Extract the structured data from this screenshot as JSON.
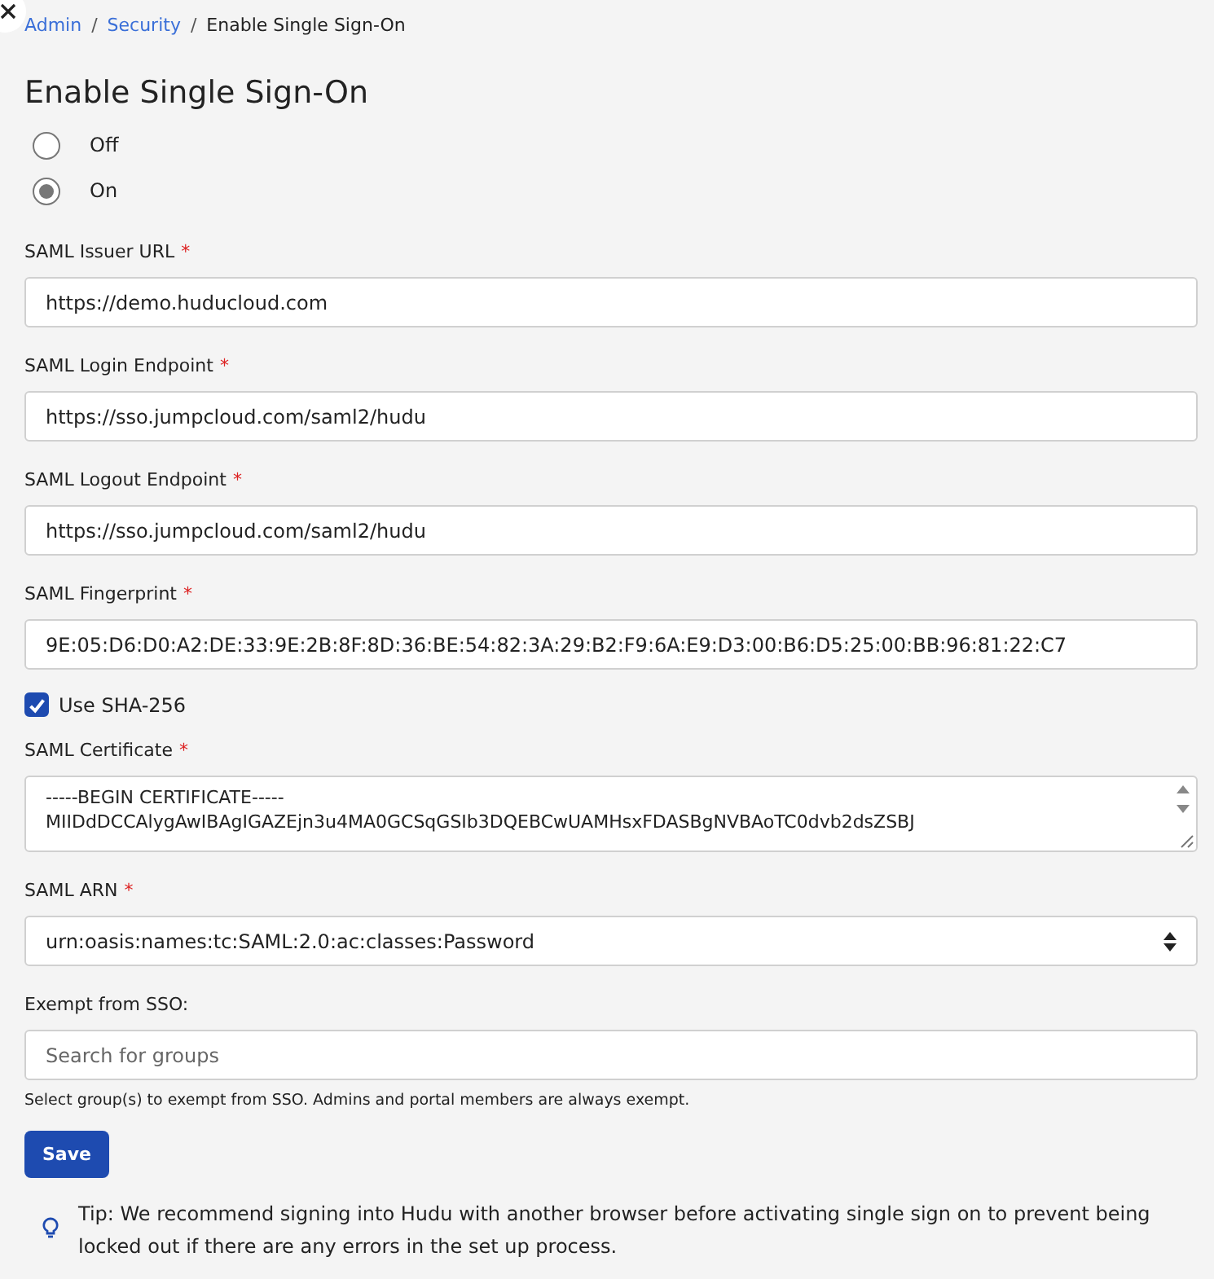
{
  "breadcrumb": [
    {
      "label": "Admin",
      "link": true
    },
    {
      "label": "Security",
      "link": true
    },
    {
      "label": "Enable Single Sign-On",
      "link": false
    }
  ],
  "breadcrumb_separator": "/",
  "title": "Enable Single Sign-On",
  "mode_options": [
    {
      "label": "Off",
      "selected": false
    },
    {
      "label": "On",
      "selected": true
    }
  ],
  "fields": [
    {
      "kind": "text",
      "label": "SAML Issuer URL",
      "required_mark": "*",
      "value": "https://demo.huducloud.com"
    },
    {
      "kind": "text",
      "label": "SAML Login Endpoint",
      "required_mark": "*",
      "value": "https://sso.jumpcloud.com/saml2/hudu"
    },
    {
      "kind": "text",
      "label": "SAML Logout Endpoint",
      "required_mark": "*",
      "value": "https://sso.jumpcloud.com/saml2/hudu"
    },
    {
      "kind": "text",
      "label": "SAML Fingerprint",
      "required_mark": "*",
      "value": "9E:05:D6:D0:A2:DE:33:9E:2B:8F:8D:36:BE:54:82:3A:29:B2:F9:6A:E9:D3:00:B6:D5:25:00:BB:96:81:22:C7"
    },
    {
      "kind": "checkbox",
      "label": "Use SHA-256",
      "checked": true
    },
    {
      "kind": "textarea",
      "label": "SAML Certificate",
      "required_mark": "*",
      "value": "-----BEGIN CERTIFICATE-----\nMIIDdDCCAlygAwIBAgIGAZEjn3u4MA0GCSqGSIb3DQEBCwUAMHsxFDASBgNVBAoTC0dvb2dsZSBJ"
    },
    {
      "kind": "select",
      "label": "SAML ARN",
      "required_mark": "*",
      "value": "urn:oasis:names:tc:SAML:2.0:ac:classes:Password"
    },
    {
      "kind": "search",
      "label": "Exempt from SSO:",
      "placeholder": "Search for groups",
      "help": "Select group(s) to exempt from SSO. Admins and portal members are always exempt."
    }
  ],
  "save_button": "Save",
  "tip": "Tip: We recommend signing into Hudu with another browser before activating single sign on to prevent being locked out if there are any errors in the set up process."
}
